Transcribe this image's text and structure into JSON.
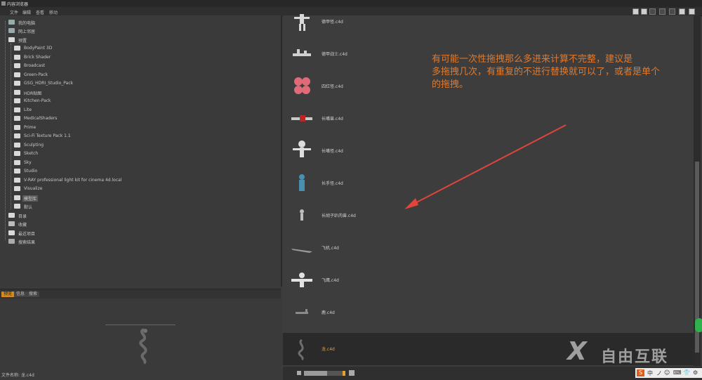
{
  "window": {
    "title": "内容浏览器"
  },
  "menu": [
    "文件",
    "编辑",
    "查看",
    "移动"
  ],
  "tree": {
    "items": [
      {
        "label": "我的电脑"
      },
      {
        "label": "网上邻居"
      },
      {
        "label": "预置"
      },
      {
        "label": "BodyPaint 3D"
      },
      {
        "label": "Brick Shader"
      },
      {
        "label": "Broadcast"
      },
      {
        "label": "Green-Pack"
      },
      {
        "label": "GSG_HDRI_Studio_Pack"
      },
      {
        "label": "HDR贴图"
      },
      {
        "label": "Kitchen-Pack"
      },
      {
        "label": "Lite"
      },
      {
        "label": "MedicalShaders"
      },
      {
        "label": "Prime"
      },
      {
        "label": "Sci-Fi Texture Pack 1.1"
      },
      {
        "label": "Sculpting"
      },
      {
        "label": "Sketch"
      },
      {
        "label": "Sky"
      },
      {
        "label": "Studio"
      },
      {
        "label": "V-RAY professional light kit for cinema 4d.local"
      },
      {
        "label": "Visualize"
      },
      {
        "label": "模型库"
      },
      {
        "label": "默认"
      },
      {
        "label": "目录"
      },
      {
        "label": "收藏"
      },
      {
        "label": "最近项目"
      },
      {
        "label": "搜索结果"
      }
    ]
  },
  "preview": {
    "tabs": [
      "预览",
      "信息",
      "搜索"
    ],
    "file_label": "文件名称:",
    "file_value": "龙.c4d"
  },
  "files": [
    {
      "name": "德甲怪.c4d"
    },
    {
      "name": "德甲战士.c4d"
    },
    {
      "name": "四红怪.c4d"
    },
    {
      "name": "长嘴兽.c4d"
    },
    {
      "name": "长嘴怪.c4d"
    },
    {
      "name": "长手怪.c4d"
    },
    {
      "name": "长胡子趴肉兽.c4d"
    },
    {
      "name": "飞机.c4d"
    },
    {
      "name": "飞鹰.c4d"
    },
    {
      "name": "鹿.c4d"
    },
    {
      "name": "龙.c4d",
      "selected": true
    }
  ],
  "annotation": {
    "line1": "有可能一次性拖拽那么多进来计算不完整，建议是",
    "line2": "多拖拽几次，有重复的不进行替换就可以了，或者是单个",
    "line3": "的拖拽。"
  },
  "watermark": {
    "text": "自由互联"
  },
  "ime": {
    "labels": [
      "S",
      "中",
      "ノ",
      "☺",
      "⌨",
      "👕",
      "⚙"
    ]
  },
  "colors": {
    "accent": "#e07a2e",
    "selection": "#e7a33e",
    "bg": "#3b3b3b"
  }
}
